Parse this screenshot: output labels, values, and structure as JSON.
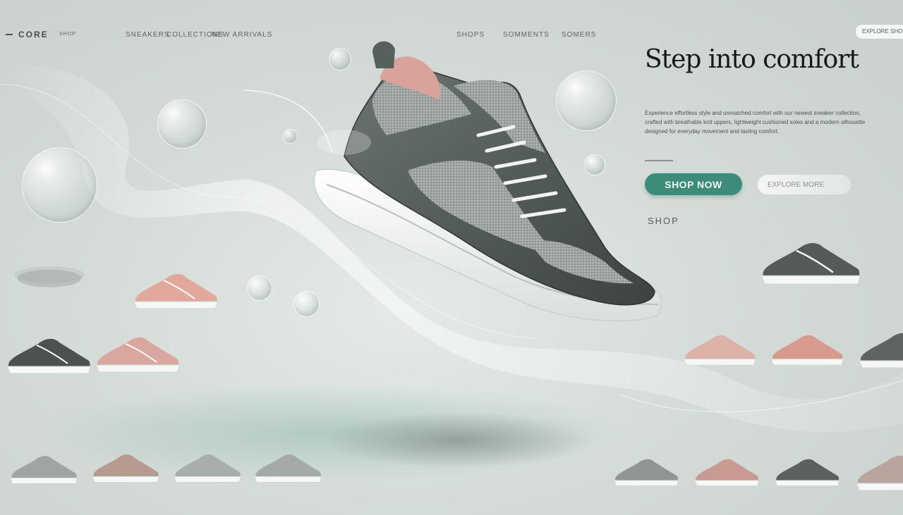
{
  "nav": {
    "brand": "CORE",
    "links": [
      "SHOP",
      "SNEAKERS",
      "COLLECTIONS",
      "NEW ARRIVALS",
      "SHOPS",
      "SOMMENTS",
      "SOMERS"
    ],
    "button_label": "EXPLORE SHOP"
  },
  "hero": {
    "title": "Step into comfort",
    "description": "Experience effortless style and unmatched comfort with our newest sneaker collection, crafted with breathable knit uppers, lightweight cushioned soles and a modern silhouette designed for everyday movement and lasting comfort.",
    "primary_cta": "SHOP NOW",
    "secondary_cta": "EXPLORE MORE",
    "shop_link": "SHOP"
  },
  "colors": {
    "accent": "#3d8c7a",
    "background": "#d5dcd8",
    "title": "#16191a"
  },
  "products": {
    "top_left": [
      {
        "name": "sneaker-grey"
      },
      {
        "name": "sneaker-peach"
      },
      {
        "name": "sneaker-black"
      },
      {
        "name": "sneaker-pink"
      }
    ],
    "bottom_left": [
      {
        "name": "sneaker-grey"
      },
      {
        "name": "sneaker-tan"
      },
      {
        "name": "sneaker-grey"
      },
      {
        "name": "sneaker-grey"
      }
    ],
    "right": [
      {
        "name": "sneaker-black"
      },
      {
        "name": "sneaker-peach"
      },
      {
        "name": "sneaker-coral"
      },
      {
        "name": "sneaker-black"
      },
      {
        "name": "sneaker-grey"
      },
      {
        "name": "sneaker-coral"
      },
      {
        "name": "sneaker-black"
      },
      {
        "name": "sneaker-peach"
      }
    ]
  }
}
